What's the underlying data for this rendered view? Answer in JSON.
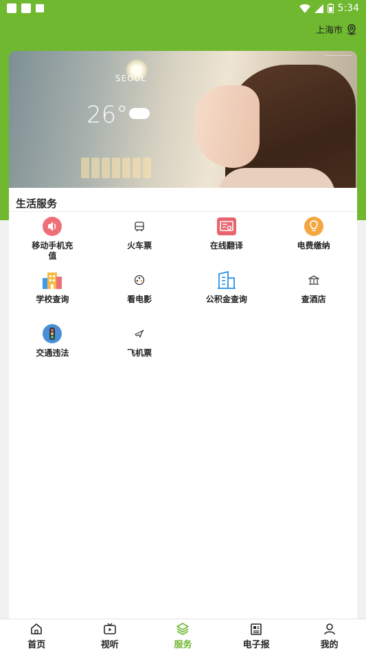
{
  "status_bar": {
    "time": "5:34"
  },
  "header": {
    "location": "上海市"
  },
  "banner": {
    "city": "SEOUL",
    "temperature": "26°"
  },
  "section": {
    "title": "生活服务",
    "items": [
      {
        "label": "移动手机充值",
        "icon": "phone-recharge-icon"
      },
      {
        "label": "火车票",
        "icon": "train-icon"
      },
      {
        "label": "在线翻译",
        "icon": "translate-icon"
      },
      {
        "label": "电费缴纳",
        "icon": "lightbulb-icon"
      },
      {
        "label": "学校查询",
        "icon": "school-building-icon"
      },
      {
        "label": "看电影",
        "icon": "film-reel-icon"
      },
      {
        "label": "公积金查询",
        "icon": "office-building-icon"
      },
      {
        "label": "查酒店",
        "icon": "hotel-icon"
      },
      {
        "label": "交通违法",
        "icon": "traffic-light-icon"
      },
      {
        "label": "飞机票",
        "icon": "airplane-icon"
      }
    ]
  },
  "tabbar": {
    "tabs": [
      {
        "label": "首页",
        "icon": "home-icon"
      },
      {
        "label": "视听",
        "icon": "tv-icon"
      },
      {
        "label": "服务",
        "icon": "layers-icon",
        "active": true
      },
      {
        "label": "电子报",
        "icon": "newspaper-icon"
      },
      {
        "label": "我的",
        "icon": "user-icon"
      }
    ]
  },
  "colors": {
    "brand_green": "#6fb830",
    "active_tab": "#6fb830"
  }
}
